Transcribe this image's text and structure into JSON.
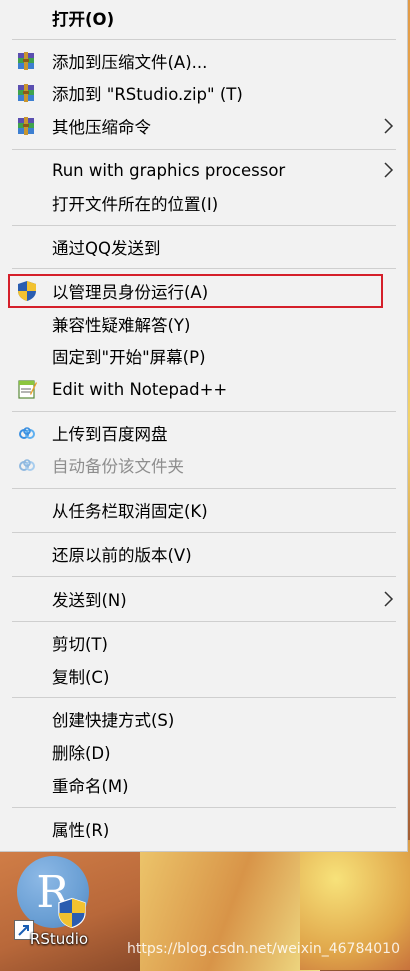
{
  "menu": {
    "items": [
      {
        "label": "打开(O)"
      },
      {
        "label": "添加到压缩文件(A)..."
      },
      {
        "label": "添加到 \"RStudio.zip\" (T)"
      },
      {
        "label": "其他压缩命令"
      },
      {
        "label": "Run with graphics processor"
      },
      {
        "label": "打开文件所在的位置(I)"
      },
      {
        "label": "通过QQ发送到"
      },
      {
        "label": "以管理员身份运行(A)"
      },
      {
        "label": "兼容性疑难解答(Y)"
      },
      {
        "label": "固定到\"开始\"屏幕(P)"
      },
      {
        "label": "Edit with Notepad++"
      },
      {
        "label": "上传到百度网盘"
      },
      {
        "label": "自动备份该文件夹"
      },
      {
        "label": "从任务栏取消固定(K)"
      },
      {
        "label": "还原以前的版本(V)"
      },
      {
        "label": "发送到(N)"
      },
      {
        "label": "剪切(T)"
      },
      {
        "label": "复制(C)"
      },
      {
        "label": "创建快捷方式(S)"
      },
      {
        "label": "删除(D)"
      },
      {
        "label": "重命名(M)"
      },
      {
        "label": "属性(R)"
      }
    ]
  },
  "desktop": {
    "icon_letter": "R",
    "icon_label": "RStudio"
  },
  "watermark": "https://blog.csdn.net/weixin_46784010",
  "colors": {
    "menu_bg": "#f2f2f2",
    "highlight_border": "#d51f2a",
    "disabled_text": "#8e8e8e"
  }
}
